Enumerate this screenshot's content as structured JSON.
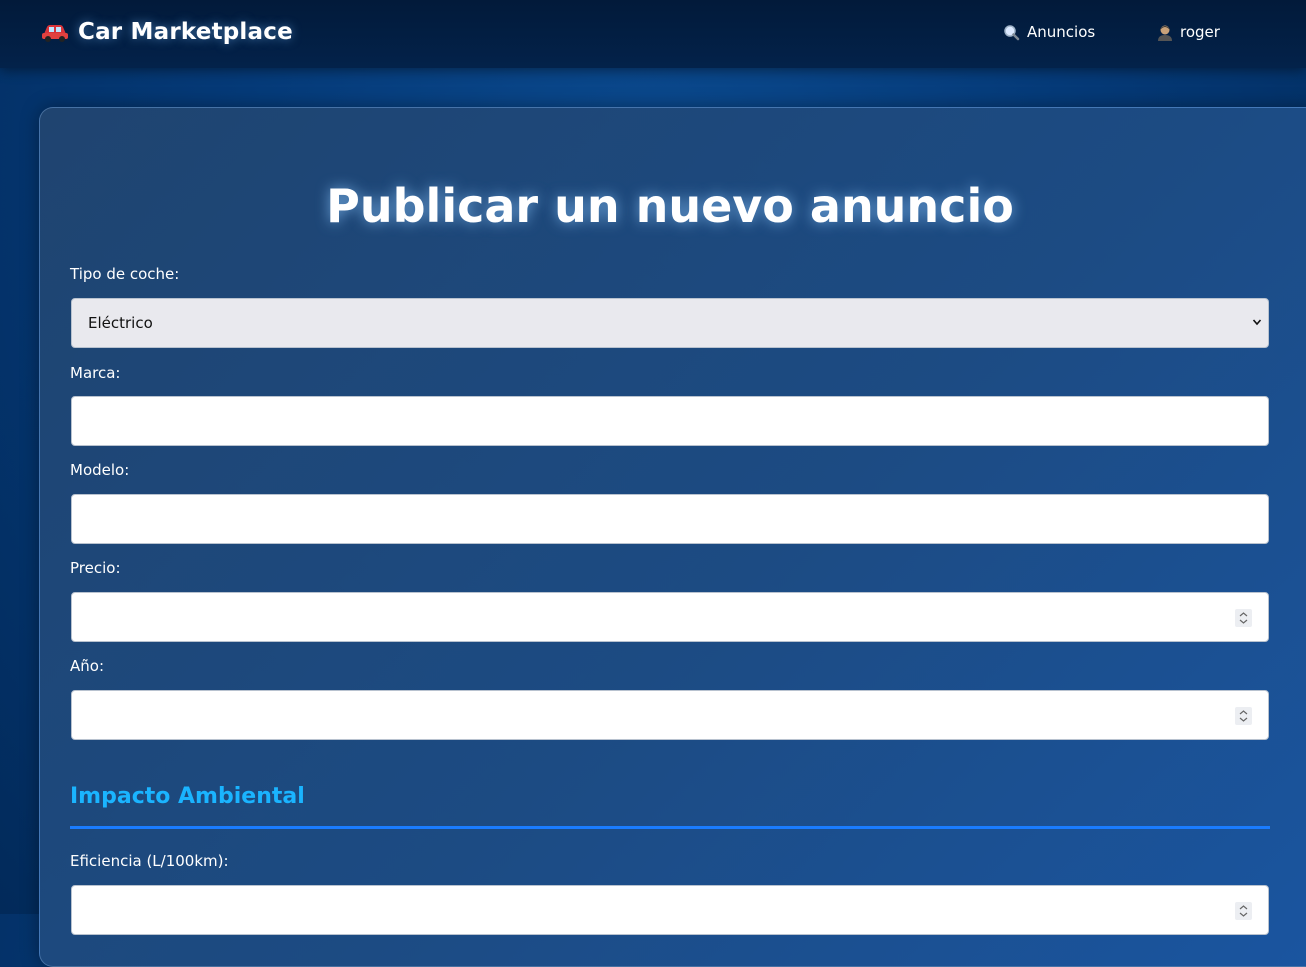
{
  "nav": {
    "brand": "Car Marketplace",
    "brand_icon": "car-icon",
    "links": [
      {
        "label": "Anuncios",
        "icon": "search-icon"
      },
      {
        "label": "roger",
        "icon": "user-icon"
      }
    ]
  },
  "form": {
    "title": "Publicar un nuevo anuncio",
    "tipo": {
      "label": "Tipo de coche:",
      "value": "Eléctrico"
    },
    "marca": {
      "label": "Marca:",
      "value": ""
    },
    "modelo": {
      "label": "Modelo:",
      "value": ""
    },
    "precio": {
      "label": "Precio:",
      "value": ""
    },
    "anio": {
      "label": "Año:",
      "value": ""
    },
    "impacto": {
      "title": "Impacto Ambiental",
      "eficiencia": {
        "label": "Eficiencia (L/100km):",
        "value": ""
      }
    }
  },
  "colors": {
    "navbar": "#021a3a",
    "accent_heading": "#1ab4ff",
    "accent_divider": "#1a7cff"
  }
}
